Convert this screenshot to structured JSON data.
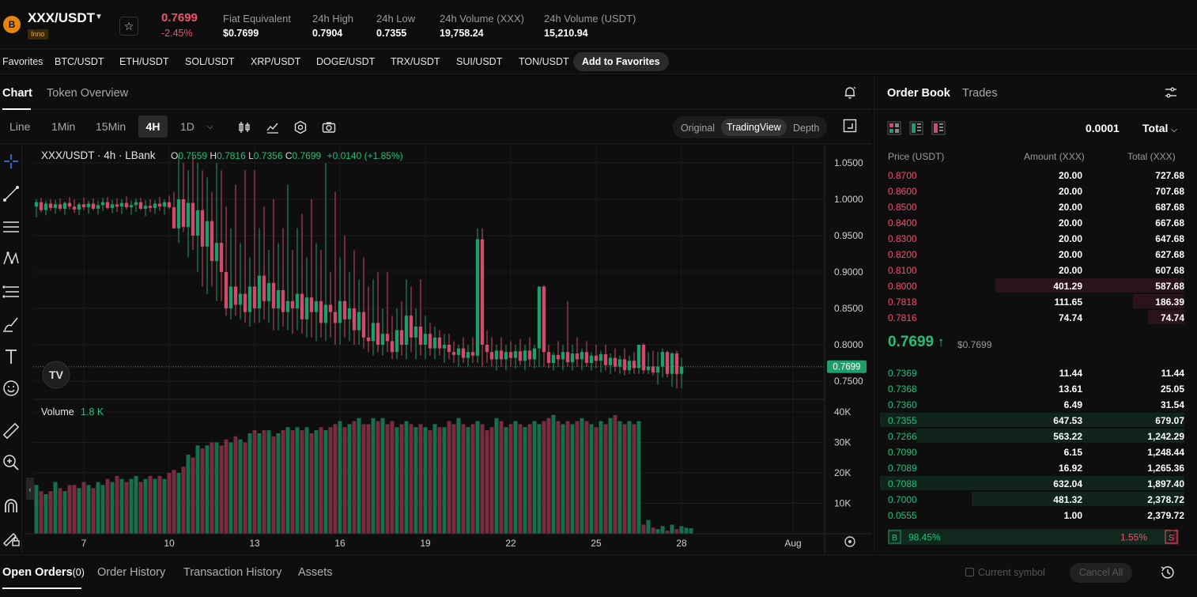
{
  "header": {
    "logo_glyph": "B",
    "pair": "XXX/USDT",
    "tag": "Inno",
    "last_price": "0.7699",
    "change": "-2.45%",
    "stats": [
      {
        "label": "Fiat Equivalent",
        "value": "$0.7699"
      },
      {
        "label": "24h High",
        "value": "0.7904"
      },
      {
        "label": "24h Low",
        "value": "0.7355"
      },
      {
        "label": "24h Volume (XXX)",
        "value": "19,758.24"
      },
      {
        "label": "24h Volume (USDT)",
        "value": "15,210.94"
      }
    ]
  },
  "favorites": {
    "label": "Favorites",
    "items": [
      "BTC/USDT",
      "ETH/USDT",
      "SOL/USDT",
      "XRP/USDT",
      "DOGE/USDT",
      "TRX/USDT",
      "SUI/USDT",
      "TON/USDT"
    ],
    "add_label": "Add to Favorites"
  },
  "chart_tabs": [
    "Chart",
    "Token Overview"
  ],
  "toolbar": {
    "intervals": [
      "Line",
      "1Min",
      "15Min",
      "4H",
      "1D"
    ],
    "view_modes": [
      "Original",
      "TradingView",
      "Depth"
    ]
  },
  "chart_data": {
    "type": "candlestick",
    "title": "XXX/USDT · 4h · LBank",
    "ohlc": {
      "o": "0.7559",
      "h": "0.7816",
      "l": "0.7356",
      "c": "0.7699",
      "change": "+0.0140 (+1.85%)"
    },
    "y_ticks": [
      "1.0500",
      "1.0000",
      "0.9500",
      "0.9000",
      "0.8500",
      "0.8000",
      "0.7500"
    ],
    "ylim": [
      0.725,
      1.075
    ],
    "current_price_label": "0.7699",
    "current_price": 0.7699,
    "x_ticks": [
      "7",
      "10",
      "13",
      "16",
      "19",
      "22",
      "25",
      "28",
      "Aug"
    ],
    "volume_label": "Volume",
    "volume_value": "1.8 K",
    "volume_ticks": [
      "40K",
      "30K",
      "20K",
      "10K"
    ],
    "volume_ylim": [
      0,
      40000
    ],
    "watermark": "TV",
    "colors": {
      "up": "#1f9d6b",
      "down": "#d24a6c",
      "vol_up": "#17704d",
      "vol_down": "#7a2b40"
    },
    "candles": [
      [
        0.99,
        1.0,
        0.975,
        0.996
      ],
      [
        0.996,
        1.002,
        0.982,
        0.985
      ],
      [
        0.985,
        0.998,
        0.978,
        0.994
      ],
      [
        0.994,
        1.0,
        0.984,
        0.988
      ],
      [
        0.988,
        0.999,
        0.98,
        0.993
      ],
      [
        0.993,
        1.001,
        0.984,
        0.987
      ],
      [
        0.987,
        0.997,
        0.979,
        0.995
      ],
      [
        0.995,
        1.003,
        0.986,
        0.99
      ],
      [
        0.99,
        1.0,
        0.981,
        0.986
      ],
      [
        0.986,
        0.996,
        0.978,
        0.993
      ],
      [
        0.993,
        1.002,
        0.985,
        0.989
      ],
      [
        0.989,
        0.998,
        0.98,
        0.994
      ],
      [
        0.994,
        1.001,
        0.985,
        0.987
      ],
      [
        0.987,
        0.998,
        0.979,
        0.992
      ],
      [
        0.992,
        1.002,
        0.984,
        0.996
      ],
      [
        0.996,
        1.003,
        0.986,
        0.988
      ],
      [
        0.988,
        0.999,
        0.981,
        0.993
      ],
      [
        0.993,
        1.001,
        0.983,
        0.99
      ],
      [
        0.99,
        1.0,
        0.98,
        0.995
      ],
      [
        0.995,
        1.004,
        0.986,
        0.989
      ],
      [
        0.989,
        0.998,
        0.979,
        0.992
      ],
      [
        0.992,
        1.001,
        0.983,
        0.996
      ],
      [
        0.996,
        1.002,
        0.985,
        0.987
      ],
      [
        0.987,
        0.999,
        0.977,
        0.991
      ],
      [
        0.991,
        1.0,
        0.982,
        0.988
      ],
      [
        0.988,
        0.999,
        0.98,
        0.994
      ],
      [
        0.994,
        1.003,
        0.984,
        0.99
      ],
      [
        0.99,
        1.0,
        0.979,
        0.996
      ],
      [
        0.996,
        1.005,
        0.986,
        0.989
      ],
      [
        0.989,
        1.01,
        0.965,
        0.96
      ],
      [
        0.96,
        1.06,
        0.94,
        1.0
      ],
      [
        1.0,
        1.05,
        0.955,
        0.962
      ],
      [
        0.962,
        1.04,
        0.92,
        0.995
      ],
      [
        0.995,
        1.06,
        0.93,
        0.95
      ],
      [
        0.95,
        1.05,
        0.9,
        0.985
      ],
      [
        0.985,
        1.04,
        0.88,
        0.935
      ],
      [
        0.935,
        1.03,
        0.87,
        0.97
      ],
      [
        0.97,
        1.01,
        0.88,
        0.915
      ],
      [
        0.915,
        1.05,
        0.86,
        0.94
      ],
      [
        0.94,
        1.04,
        0.86,
        0.9
      ],
      [
        0.9,
        0.99,
        0.84,
        0.85
      ],
      [
        0.85,
        0.96,
        0.835,
        0.88
      ],
      [
        0.88,
        1.02,
        0.84,
        0.855
      ],
      [
        0.855,
        0.94,
        0.835,
        0.87
      ],
      [
        0.87,
        1.04,
        0.83,
        0.845
      ],
      [
        0.845,
        0.92,
        0.825,
        0.88
      ],
      [
        0.88,
        1.04,
        0.83,
        0.85
      ],
      [
        0.85,
        0.96,
        0.83,
        0.895
      ],
      [
        0.895,
        0.99,
        0.835,
        0.86
      ],
      [
        0.86,
        0.93,
        0.83,
        0.885
      ],
      [
        0.885,
        1.0,
        0.82,
        0.85
      ],
      [
        0.85,
        0.94,
        0.82,
        0.875
      ],
      [
        0.875,
        0.96,
        0.825,
        0.845
      ],
      [
        0.845,
        1.02,
        0.82,
        0.86
      ],
      [
        0.86,
        0.93,
        0.815,
        0.85
      ],
      [
        0.85,
        0.96,
        0.82,
        0.87
      ],
      [
        0.87,
        0.98,
        0.815,
        0.835
      ],
      [
        0.835,
        0.92,
        0.81,
        0.865
      ],
      [
        0.865,
        1.0,
        0.81,
        0.845
      ],
      [
        0.845,
        0.94,
        0.805,
        0.86
      ],
      [
        0.86,
        0.93,
        0.81,
        0.83
      ],
      [
        0.83,
        1.05,
        0.805,
        0.855
      ],
      [
        0.855,
        0.9,
        0.81,
        0.845
      ],
      [
        0.845,
        1.01,
        0.8,
        0.83
      ],
      [
        0.83,
        0.92,
        0.8,
        0.86
      ],
      [
        0.86,
        0.95,
        0.81,
        0.835
      ],
      [
        0.835,
        0.9,
        0.805,
        0.85
      ],
      [
        0.85,
        0.93,
        0.8,
        0.82
      ],
      [
        0.82,
        0.89,
        0.8,
        0.845
      ],
      [
        0.845,
        0.92,
        0.795,
        0.81
      ],
      [
        0.81,
        0.88,
        0.79,
        0.805
      ],
      [
        0.805,
        0.89,
        0.785,
        0.83
      ],
      [
        0.83,
        0.9,
        0.79,
        0.8
      ],
      [
        0.8,
        0.85,
        0.785,
        0.815
      ],
      [
        0.815,
        0.9,
        0.79,
        0.805
      ],
      [
        0.805,
        0.84,
        0.78,
        0.79
      ],
      [
        0.79,
        0.85,
        0.78,
        0.82
      ],
      [
        0.82,
        0.86,
        0.785,
        0.8
      ],
      [
        0.8,
        0.89,
        0.78,
        0.84
      ],
      [
        0.84,
        0.88,
        0.79,
        0.81
      ],
      [
        0.81,
        0.85,
        0.78,
        0.825
      ],
      [
        0.825,
        0.89,
        0.785,
        0.8
      ],
      [
        0.8,
        0.84,
        0.78,
        0.815
      ],
      [
        0.815,
        0.83,
        0.785,
        0.795
      ],
      [
        0.795,
        0.825,
        0.78,
        0.81
      ],
      [
        0.81,
        0.82,
        0.785,
        0.795
      ],
      [
        0.795,
        0.815,
        0.775,
        0.8
      ],
      [
        0.8,
        0.815,
        0.78,
        0.79
      ],
      [
        0.79,
        0.805,
        0.775,
        0.786
      ],
      [
        0.786,
        0.8,
        0.77,
        0.795
      ],
      [
        0.795,
        0.81,
        0.775,
        0.782
      ],
      [
        0.782,
        0.8,
        0.77,
        0.79
      ],
      [
        0.79,
        0.81,
        0.775,
        0.785
      ],
      [
        0.785,
        0.96,
        0.775,
        0.945
      ],
      [
        0.945,
        0.96,
        0.77,
        0.8
      ],
      [
        0.8,
        0.82,
        0.775,
        0.79
      ],
      [
        0.79,
        0.81,
        0.77,
        0.78
      ],
      [
        0.78,
        0.8,
        0.765,
        0.792
      ],
      [
        0.792,
        0.81,
        0.77,
        0.78
      ],
      [
        0.78,
        0.8,
        0.765,
        0.79
      ],
      [
        0.79,
        0.805,
        0.77,
        0.782
      ],
      [
        0.782,
        0.8,
        0.768,
        0.791
      ],
      [
        0.791,
        0.808,
        0.772,
        0.778
      ],
      [
        0.778,
        0.8,
        0.765,
        0.792
      ],
      [
        0.792,
        0.81,
        0.77,
        0.78
      ],
      [
        0.78,
        0.8,
        0.768,
        0.795
      ],
      [
        0.795,
        0.88,
        0.77,
        0.88
      ],
      [
        0.88,
        0.882,
        0.77,
        0.79
      ],
      [
        0.79,
        0.8,
        0.768,
        0.775
      ],
      [
        0.775,
        0.79,
        0.765,
        0.786
      ],
      [
        0.786,
        0.805,
        0.77,
        0.78
      ],
      [
        0.78,
        0.8,
        0.765,
        0.79
      ],
      [
        0.79,
        0.86,
        0.77,
        0.776
      ],
      [
        0.776,
        0.8,
        0.765,
        0.788
      ],
      [
        0.788,
        0.81,
        0.77,
        0.78
      ],
      [
        0.78,
        0.795,
        0.765,
        0.79
      ],
      [
        0.79,
        0.805,
        0.77,
        0.775
      ],
      [
        0.775,
        0.79,
        0.765,
        0.785
      ],
      [
        0.785,
        0.8,
        0.768,
        0.778
      ],
      [
        0.778,
        0.792,
        0.762,
        0.787
      ],
      [
        0.787,
        0.8,
        0.765,
        0.772
      ],
      [
        0.772,
        0.788,
        0.76,
        0.782
      ],
      [
        0.782,
        0.795,
        0.763,
        0.77
      ],
      [
        0.77,
        0.785,
        0.76,
        0.78
      ],
      [
        0.78,
        0.795,
        0.758,
        0.765
      ],
      [
        0.765,
        0.785,
        0.76,
        0.778
      ],
      [
        0.778,
        0.79,
        0.76,
        0.768
      ],
      [
        0.768,
        0.8,
        0.76,
        0.8
      ],
      [
        0.8,
        0.802,
        0.76,
        0.765
      ],
      [
        0.765,
        0.79,
        0.76,
        0.77
      ],
      [
        0.77,
        0.792,
        0.758,
        0.762
      ],
      [
        0.762,
        0.79,
        0.745,
        0.77
      ],
      [
        0.77,
        0.795,
        0.755,
        0.79
      ],
      [
        0.79,
        0.792,
        0.755,
        0.76
      ],
      [
        0.76,
        0.79,
        0.742,
        0.788
      ],
      [
        0.788,
        0.792,
        0.74,
        0.76
      ],
      [
        0.76,
        0.782,
        0.74,
        0.7699
      ]
    ],
    "volumes": [
      16000,
      14000,
      13000,
      14000,
      17000,
      15000,
      14000,
      16000,
      16000,
      15000,
      17000,
      16000,
      15000,
      17000,
      16000,
      18000,
      17000,
      19000,
      18000,
      17000,
      18000,
      19000,
      17000,
      18000,
      19000,
      18000,
      19000,
      18000,
      20000,
      21000,
      20000,
      22000,
      26000,
      25000,
      29000,
      28000,
      29000,
      30000,
      30000,
      29000,
      31000,
      30000,
      32000,
      31000,
      30000,
      33000,
      34000,
      33000,
      34000,
      34000,
      32000,
      33000,
      34000,
      35000,
      34000,
      35000,
      34000,
      35000,
      33000,
      34000,
      35000,
      34000,
      35000,
      36000,
      37000,
      35000,
      36000,
      37000,
      38000,
      36000,
      36000,
      38000,
      37000,
      38000,
      36000,
      37000,
      35000,
      36000,
      37000,
      36000,
      35000,
      36000,
      35000,
      34000,
      36000,
      35000,
      35000,
      37000,
      36000,
      38000,
      36000,
      35000,
      36000,
      37000,
      36000,
      34000,
      35000,
      38000,
      37000,
      35000,
      36000,
      37000,
      36000,
      35000,
      36000,
      37000,
      36000,
      37000,
      38000,
      39000,
      37000,
      36000,
      37000,
      36000,
      37000,
      38000,
      37000,
      36000,
      35000,
      37000,
      36000,
      38000,
      39000,
      37000,
      36000,
      37000,
      36000,
      37000,
      3000,
      4500,
      2000,
      1500,
      2500,
      1000,
      3000,
      1500,
      2500,
      2000,
      1800
    ]
  },
  "orderbook": {
    "tabs": [
      "Order Book",
      "Trades"
    ],
    "precision": "0.0001",
    "total_mode": "Total",
    "headers": [
      "Price (USDT)",
      "Amount (XXX)",
      "Total (XXX)"
    ],
    "asks": [
      {
        "price": "0.8700",
        "amount": "20.00",
        "total": "727.68",
        "depth": 0
      },
      {
        "price": "0.8600",
        "amount": "20.00",
        "total": "707.68",
        "depth": 0
      },
      {
        "price": "0.8500",
        "amount": "20.00",
        "total": "687.68",
        "depth": 0
      },
      {
        "price": "0.8400",
        "amount": "20.00",
        "total": "667.68",
        "depth": 0
      },
      {
        "price": "0.8300",
        "amount": "20.00",
        "total": "647.68",
        "depth": 0
      },
      {
        "price": "0.8200",
        "amount": "20.00",
        "total": "627.68",
        "depth": 0
      },
      {
        "price": "0.8100",
        "amount": "20.00",
        "total": "607.68",
        "depth": 0
      },
      {
        "price": "0.8000",
        "amount": "401.29",
        "total": "587.68",
        "depth": 0.62
      },
      {
        "price": "0.7818",
        "amount": "111.65",
        "total": "186.39",
        "depth": 0.17
      },
      {
        "price": "0.7816",
        "amount": "74.74",
        "total": "74.74",
        "depth": 0.12
      }
    ],
    "last_price": "0.7699",
    "last_fiat": "$0.7699",
    "bids": [
      {
        "price": "0.7369",
        "amount": "11.44",
        "total": "11.44",
        "depth": 0
      },
      {
        "price": "0.7368",
        "amount": "13.61",
        "total": "25.05",
        "depth": 0
      },
      {
        "price": "0.7360",
        "amount": "6.49",
        "total": "31.54",
        "depth": 0
      },
      {
        "price": "0.7355",
        "amount": "647.53",
        "total": "679.07",
        "depth": 1.0
      },
      {
        "price": "0.7266",
        "amount": "563.22",
        "total": "1,242.29",
        "depth": 0.88
      },
      {
        "price": "0.7090",
        "amount": "6.15",
        "total": "1,248.44",
        "depth": 0
      },
      {
        "price": "0.7089",
        "amount": "16.92",
        "total": "1,265.36",
        "depth": 0
      },
      {
        "price": "0.7088",
        "amount": "632.04",
        "total": "1,897.40",
        "depth": 1.0
      },
      {
        "price": "0.7000",
        "amount": "481.32",
        "total": "2,378.72",
        "depth": 0.7
      },
      {
        "price": "0.0555",
        "amount": "1.00",
        "total": "2,379.72",
        "depth": 0
      }
    ],
    "buy_label": "B",
    "buy_pct": "98.45%",
    "buy_ratio": 0.9845,
    "sell_label": "S",
    "sell_pct": "1.55%"
  },
  "bottom_tabs": {
    "open_orders": "Open Orders",
    "open_count": "(0)",
    "others": [
      "Order History",
      "Transaction History",
      "Assets"
    ],
    "current_symbol": "Current symbol",
    "cancel_all": "Cancel All"
  }
}
